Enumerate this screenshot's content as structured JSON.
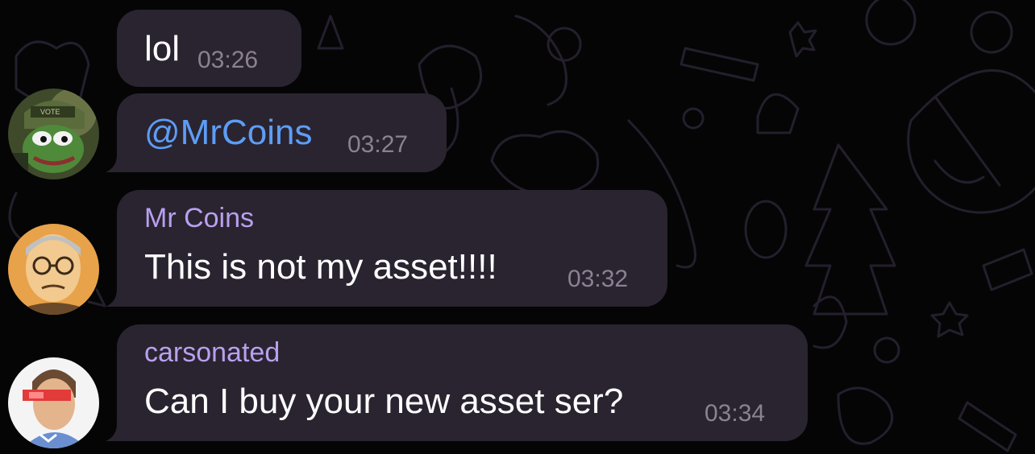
{
  "chat": {
    "messages": [
      {
        "sender": "",
        "text": "lol",
        "time": "03:26"
      },
      {
        "sender": "",
        "text": "@MrCoins",
        "time": "03:27"
      },
      {
        "sender": "Mr Coins",
        "text": "This is not my asset!!!!",
        "time": "03:32"
      },
      {
        "sender": "carsonated",
        "text": "Can I buy your new asset ser?",
        "time": "03:34"
      }
    ]
  },
  "colors": {
    "background": "#050506",
    "bubble": "#2a2430",
    "sender_name": "#b9a0ef",
    "mention": "#5d9df5",
    "timestamp": "#8a8291"
  },
  "icons": [
    "doodle-pattern",
    "pepe-avatar",
    "mr-coins-avatar",
    "carsonated-avatar"
  ]
}
